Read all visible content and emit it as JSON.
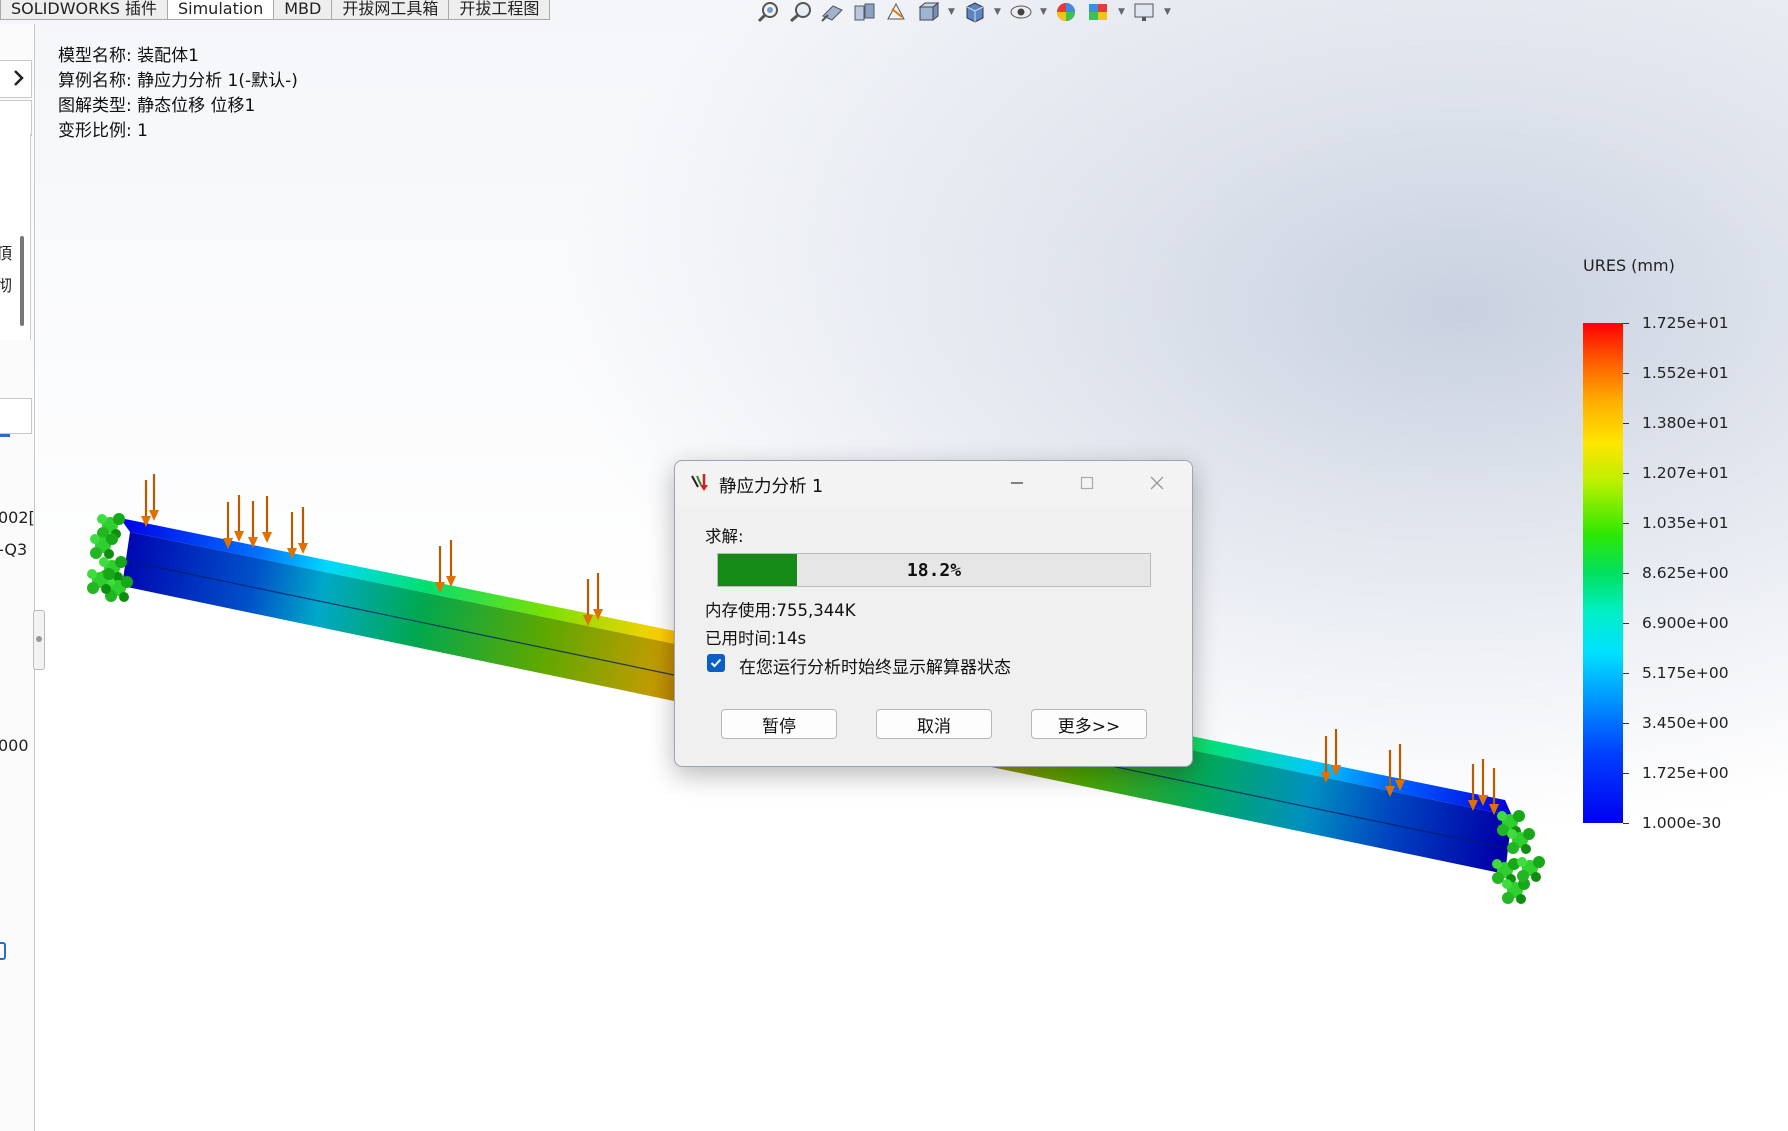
{
  "tabs": [
    "SOLIDWORKS 插件",
    "Simulation",
    "MBD",
    "开拔网工具箱",
    "开拔工程图"
  ],
  "left_panel": {
    "fragments": [
      "頂",
      "彻",
      "002[",
      "-Q3",
      "000"
    ]
  },
  "model_info": {
    "model_name": "模型名称: 装配体1",
    "study_name": "算例名称: 静应力分析 1(-默认-)",
    "plot_type": "图解类型: 静态位移 位移1",
    "deform_scale": "变形比例: 1"
  },
  "legend": {
    "title": "URES (mm)",
    "labels": [
      "1.725e+01",
      "1.552e+01",
      "1.380e+01",
      "1.207e+01",
      "1.035e+01",
      "8.625e+00",
      "6.900e+00",
      "5.175e+00",
      "3.450e+00",
      "1.725e+00",
      "1.000e-30"
    ],
    "colors": [
      "#ff0000",
      "#ff6000",
      "#ffb000",
      "#ffe600",
      "#b8f000",
      "#30e800",
      "#00e060",
      "#00f0c8",
      "#00e0ff",
      "#0090ff",
      "#0040ff",
      "#0000f0"
    ]
  },
  "toolbar_icons": [
    "zoom-to-fit-icon",
    "zoom-area-icon",
    "previous-view-icon",
    "section-view-icon",
    "dynamic-annotation-icon",
    "view-orientation-icon",
    "display-style-icon",
    "hide-show-icon",
    "edit-appearance-icon",
    "apply-scene-icon",
    "view-settings-icon"
  ],
  "dialog": {
    "title": "静应力分析 1",
    "solve_label": "求解:",
    "progress": 0.182,
    "progress_text": "18.2%",
    "memory": "内存使用:755,344K",
    "elapsed": "已用时间:14s",
    "checkbox_label": "在您运行分析时始终显示解算器状态",
    "checkbox_checked": true,
    "buttons": {
      "pause": "暂停",
      "cancel": "取消",
      "more": "更多>>"
    }
  }
}
